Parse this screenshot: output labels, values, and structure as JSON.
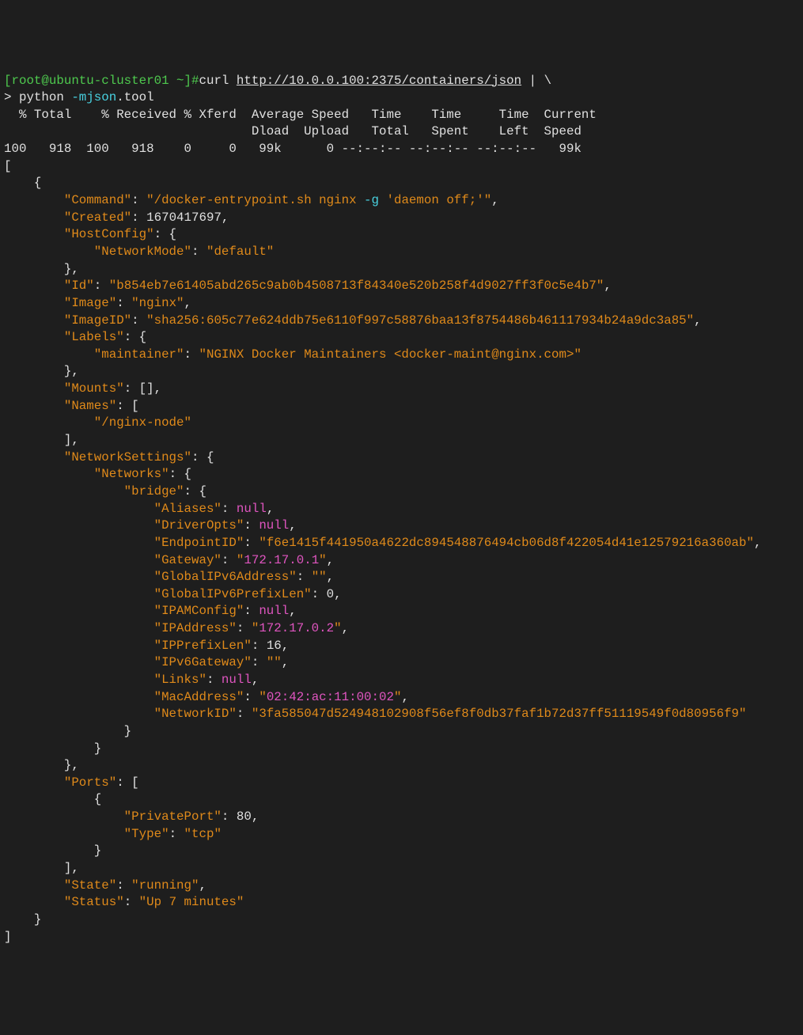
{
  "prompt": {
    "user_host": "[root@ubuntu-cluster01 ~]#",
    "continuation": "> ",
    "cmd_curl": "curl ",
    "url": "http://10.0.0.100:2375/containers/json",
    "pipe": " | \\",
    "cmd_python": "python ",
    "flag_m": "-mjson",
    "tool": ".tool"
  },
  "curl_header": {
    "l1": "  % Total    % Received % Xferd  Average Speed   Time    Time     Time  Current",
    "l2": "                                 Dload  Upload   Total   Spent    Left  Speed",
    "l3": "100   918  100   918    0     0   99k      0 --:--:-- --:--:-- --:--:--   99k"
  },
  "json": {
    "open": "[",
    "obj_open": "    {",
    "command_k": "        \"Command\"",
    "command_v": "\"/docker-entrypoint.sh nginx ",
    "command_g": "-g",
    "command_v2": " 'daemon off;'\"",
    "created_k": "        \"Created\"",
    "created_v": "1670417697",
    "hostconfig_k": "        \"HostConfig\"",
    "networkmode_k": "            \"NetworkMode\"",
    "networkmode_v": "\"default\"",
    "close_brace1": "        },",
    "id_k": "        \"Id\"",
    "id_v": "\"b854eb7e61405abd265c9ab0b4508713f84340e520b258f4d9027ff3f0c5e4b7\"",
    "image_k": "        \"Image\"",
    "image_v": "\"nginx\"",
    "imageid_k": "        \"ImageID\"",
    "imageid_v": "\"sha256:605c77e624ddb75e6110f997c58876baa13f8754486b461117934b24a9dc3a85\"",
    "labels_k": "        \"Labels\"",
    "maintainer_k": "            \"maintainer\"",
    "maintainer_v": "\"NGINX Docker Maintainers <docker-maint@nginx.com>\"",
    "close_brace2": "        },",
    "mounts_k": "        \"Mounts\"",
    "mounts_v": "[]",
    "names_k": "        \"Names\"",
    "names_v": "            \"/nginx-node\"",
    "close_bracket1": "        ],",
    "networksettings_k": "        \"NetworkSettings\"",
    "networks_k": "            \"Networks\"",
    "bridge_k": "                \"bridge\"",
    "aliases_k": "                    \"Aliases\"",
    "null1": "null",
    "driveropts_k": "                    \"DriverOpts\"",
    "null2": "null",
    "endpointid_k": "                    \"EndpointID\"",
    "endpointid_v": "\"f6e1415f441950a4622dc894548876494cb06d8f422054d41e12579216a360ab\"",
    "gateway_k": "                    \"Gateway\"",
    "gateway_v": "\"172.17.0.1\"",
    "globalipv6_k": "                    \"GlobalIPv6Address\"",
    "globalipv6_v": "\"\"",
    "globalipv6p_k": "                    \"GlobalIPv6PrefixLen\"",
    "globalipv6p_v": "0",
    "ipamconfig_k": "                    \"IPAMConfig\"",
    "null3": "null",
    "ipaddress_k": "                    \"IPAddress\"",
    "ipaddress_v": "\"172.17.0.2\"",
    "ipprefixlen_k": "                    \"IPPrefixLen\"",
    "ipprefixlen_v": "16",
    "ipv6gateway_k": "                    \"IPv6Gateway\"",
    "ipv6gateway_v": "\"\"",
    "links_k": "                    \"Links\"",
    "null4": "null",
    "macaddress_k": "                    \"MacAddress\"",
    "macaddress_v": "\"02:42:ac:11:00:02\"",
    "networkid_k": "                    \"NetworkID\"",
    "networkid_v": "\"3fa585047d524948102908f56ef8f0db37faf1b72d37ff51119549f0d80956f9\"",
    "close_brace3": "                }",
    "close_brace4": "            }",
    "close_brace5": "        },",
    "ports_k": "        \"Ports\"",
    "ports_open": "            {",
    "privateport_k": "                \"PrivatePort\"",
    "privateport_v": "80",
    "type_k": "                \"Type\"",
    "type_v": "\"tcp\"",
    "close_brace6": "            }",
    "close_bracket2": "        ],",
    "state_k": "        \"State\"",
    "state_v": "\"running\"",
    "status_k": "        \"Status\"",
    "status_v": "\"Up 7 minutes\"",
    "obj_close": "    }",
    "close": "]"
  }
}
